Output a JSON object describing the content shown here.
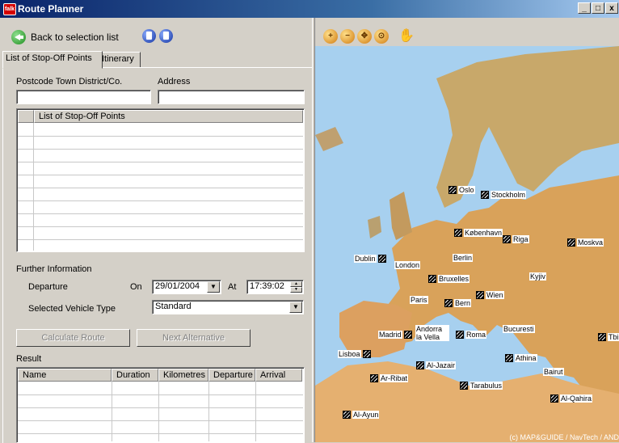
{
  "window": {
    "title": "Route Planner",
    "app_icon": "falk-logo-icon",
    "minimize": "_",
    "maximize": "□",
    "close": "x"
  },
  "toolbar": {
    "back_label": "Back to selection list"
  },
  "tabs": [
    {
      "label": "List of Stop-Off Points",
      "active": true
    },
    {
      "label": "Itinerary",
      "active": false
    }
  ],
  "search": {
    "postcode_label": "Postcode Town District/Co.",
    "address_label": "Address",
    "postcode_value": "",
    "address_value": ""
  },
  "stopoff_grid": {
    "header": "List of Stop-Off Points",
    "rows": []
  },
  "further": {
    "section_label": "Further Information",
    "departure_label": "Departure",
    "on_label": "On",
    "date_value": "29/01/2004",
    "at_label": "At",
    "time_value": "17:39:02",
    "vehicle_label": "Selected Vehicle Type",
    "vehicle_value": "Standard"
  },
  "buttons": {
    "calculate": "Calculate Route",
    "next_alt": "Next Alternative"
  },
  "result": {
    "label": "Result",
    "columns": [
      "Name",
      "Duration",
      "Kilometres",
      "Departure",
      "Arrival"
    ],
    "rows": []
  },
  "map": {
    "tools": [
      "zoom-in-icon",
      "zoom-out-icon",
      "pan-icon",
      "zoom-extent-icon",
      "hand-icon"
    ],
    "cities": [
      "Oslo",
      "Stockholm",
      "København",
      "Riga",
      "Moskva",
      "Dublin",
      "London",
      "Berlin",
      "Bruxelles",
      "Kyjiv",
      "Paris",
      "Wien",
      "Bern",
      "Bucuresti",
      "Madrid",
      "Andorra la Vella",
      "Roma",
      "Lisboa",
      "Al-Jazair",
      "Athina",
      "Ar-Ribat",
      "Bairut",
      "Tarabulus",
      "Al-Qahira",
      "Al-Ayun",
      "Tbi"
    ],
    "copyright": "(c) MAP&GUIDE / NavTech / AND"
  }
}
